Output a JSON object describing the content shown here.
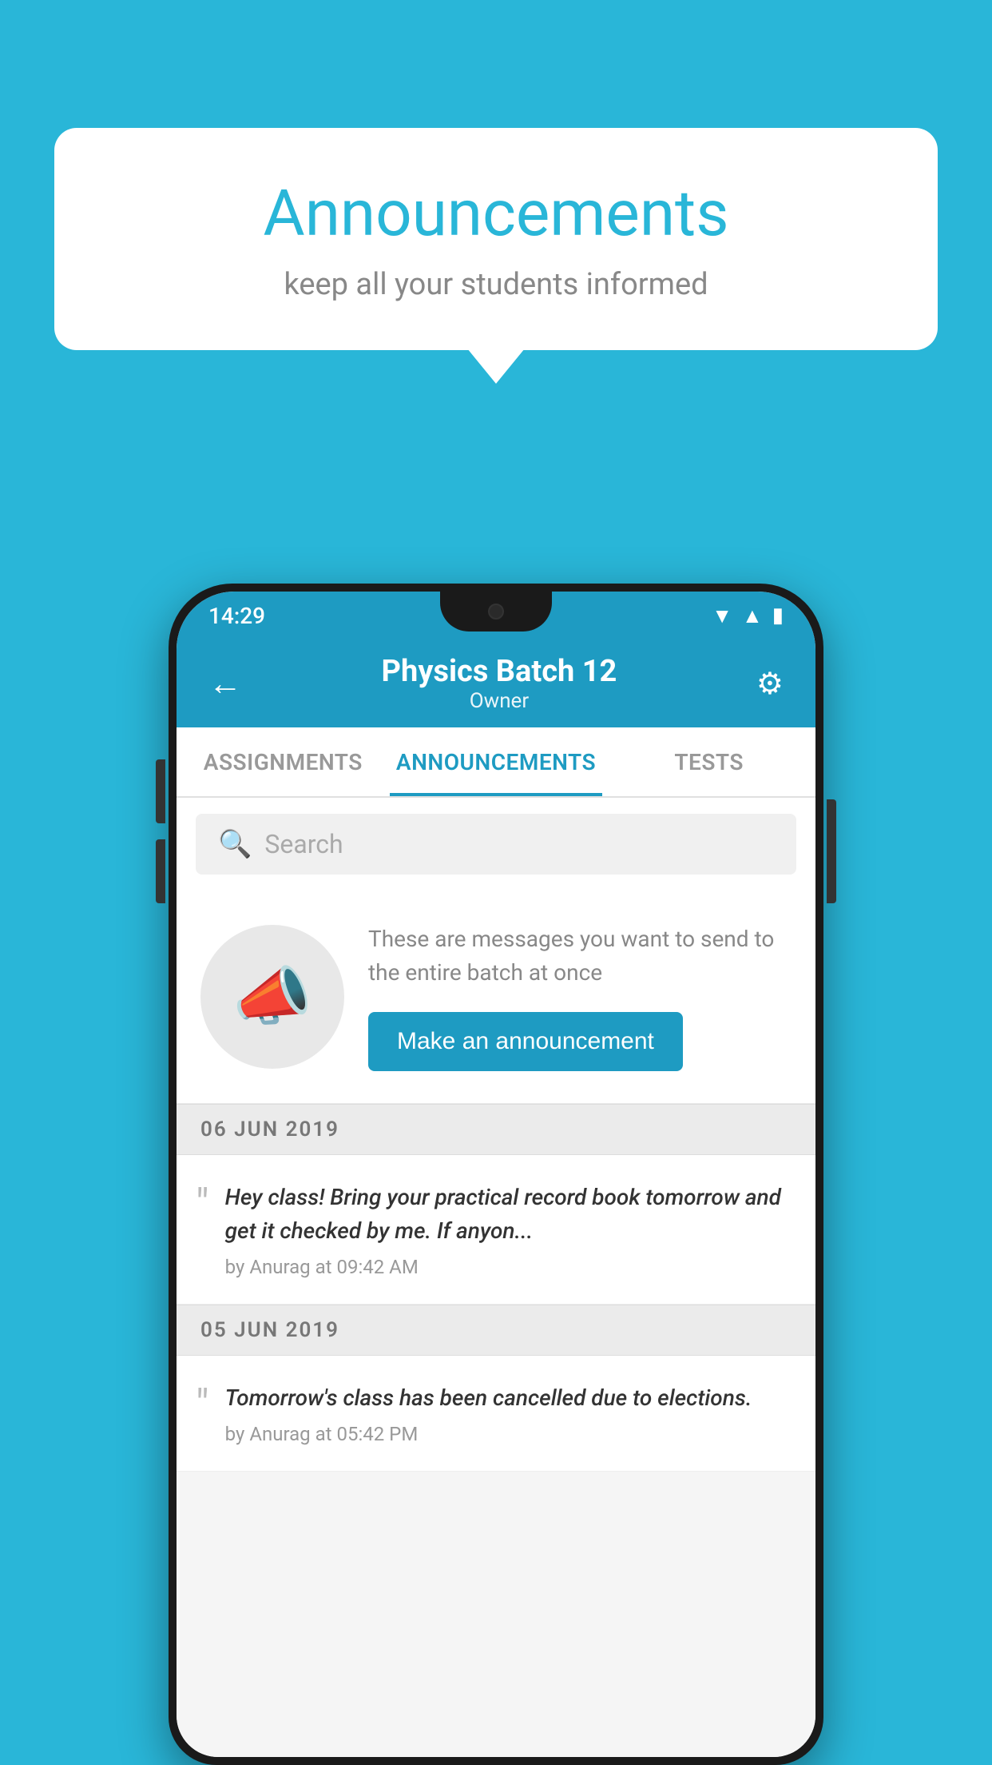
{
  "page": {
    "background_color": "#29b6d8"
  },
  "speech_bubble": {
    "title": "Announcements",
    "subtitle": "keep all your students informed"
  },
  "app_bar": {
    "title": "Physics Batch 12",
    "subtitle": "Owner",
    "back_label": "←",
    "settings_label": "⚙"
  },
  "tabs": [
    {
      "label": "ASSIGNMENTS",
      "active": false
    },
    {
      "label": "ANNOUNCEMENTS",
      "active": true
    },
    {
      "label": "TESTS",
      "active": false
    }
  ],
  "search": {
    "placeholder": "Search"
  },
  "promo": {
    "description": "These are messages you want to send to the entire batch at once",
    "button_label": "Make an announcement"
  },
  "dates": [
    {
      "label": "06  JUN  2019",
      "announcements": [
        {
          "text": "Hey class! Bring your practical record book tomorrow and get it checked by me. If anyon...",
          "meta": "by Anurag at 09:42 AM"
        }
      ]
    },
    {
      "label": "05  JUN  2019",
      "announcements": [
        {
          "text": "Tomorrow's class has been cancelled due to elections.",
          "meta": "by Anurag at 05:42 PM"
        }
      ]
    }
  ],
  "status_bar": {
    "time": "14:29"
  }
}
